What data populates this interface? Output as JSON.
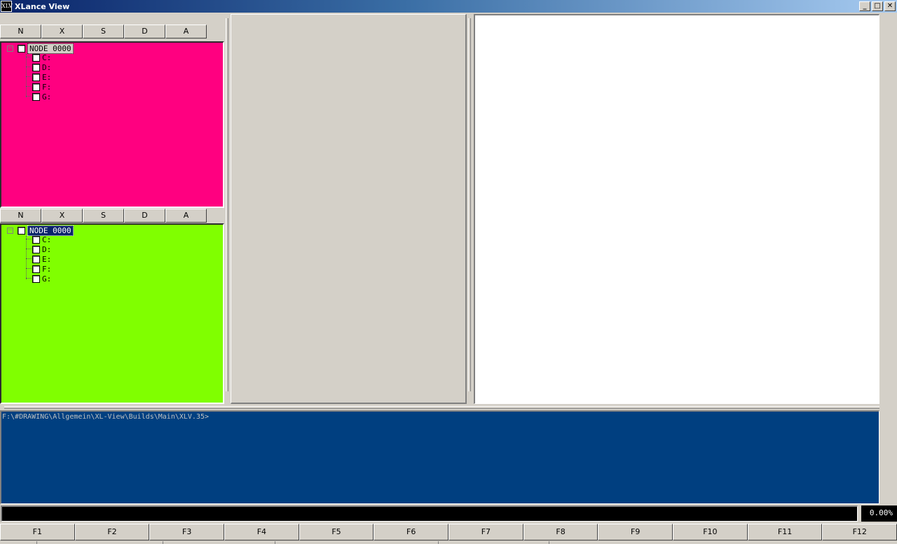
{
  "window": {
    "title": "XLance View",
    "icon_text": "XLV",
    "controls": {
      "minimize": "_",
      "maximize": "□",
      "close": "✕"
    }
  },
  "top_panel": {
    "tabs": [
      "N",
      "X",
      "S",
      "D",
      "A"
    ],
    "background": "#ff0080",
    "node": {
      "expander": "−",
      "label": "NODE 0000"
    },
    "drives": [
      "C:",
      "D:",
      "E:",
      "F:",
      "G:"
    ]
  },
  "bottom_panel": {
    "tabs": [
      "N",
      "X",
      "S",
      "D",
      "A"
    ],
    "background": "#80ff00",
    "node": {
      "expander": "−",
      "label": "NODE 0000"
    },
    "drives": [
      "C:",
      "D:",
      "E:",
      "F:",
      "G:"
    ]
  },
  "console": {
    "background": "#003f80",
    "prompt": "F:\\#DRAWING\\Allgemein\\XL-View\\Builds\\Main\\XLV.35>"
  },
  "command_line": {
    "value": ""
  },
  "progress": {
    "text": "0.00%",
    "value": 0
  },
  "function_keys": [
    "F1",
    "F2",
    "F3",
    "F4",
    "F5",
    "F6",
    "F7",
    "F8",
    "F9",
    "F10",
    "F11",
    "F12"
  ]
}
